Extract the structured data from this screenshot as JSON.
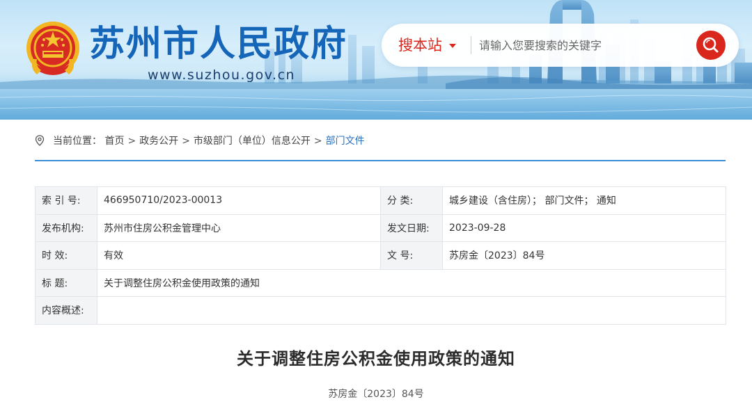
{
  "header": {
    "site_title": "苏州市人民政府",
    "site_url": "www.suzhou.gov.cn",
    "brand_color": "#1565b8"
  },
  "search": {
    "scope_label": "搜本站",
    "placeholder": "请输入您要搜索的关键字",
    "accent_color": "#d9271d",
    "button_icon": "search-icon"
  },
  "breadcrumb": {
    "prefix": "当前位置：",
    "separator": ">",
    "items": [
      "首页",
      "政务公开",
      "市级部门（单位）信息公开",
      "部门文件"
    ]
  },
  "info_table": {
    "rows": [
      [
        {
          "label": "索 引 号:",
          "value": "466950710/2023-00013"
        },
        {
          "label": "分      类:",
          "value": "城乡建设（含住房）； 部门文件； 通知"
        }
      ],
      [
        {
          "label": "发布机构:",
          "value": "苏州市住房公积金管理中心"
        },
        {
          "label": "发文日期:",
          "value": "2023-09-28"
        }
      ],
      [
        {
          "label": "时      效:",
          "value": "有效"
        },
        {
          "label": "文      号:",
          "value": "苏房金〔2023〕84号"
        }
      ],
      [
        {
          "label": "标      题:",
          "value": "关于调整住房公积金使用政策的通知"
        }
      ],
      [
        {
          "label": "内容概述:",
          "value": ""
        }
      ]
    ]
  },
  "article": {
    "title": "关于调整住房公积金使用政策的通知",
    "doc_number": "苏房金〔2023〕84号"
  }
}
